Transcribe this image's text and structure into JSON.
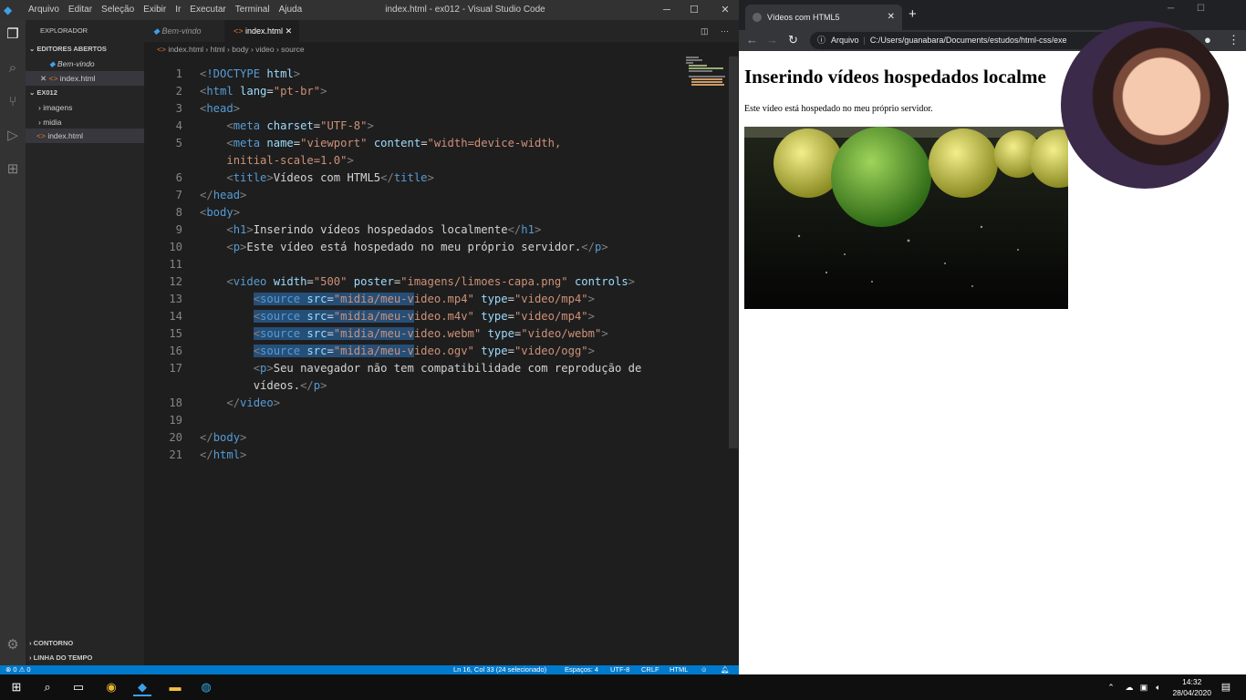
{
  "vscode": {
    "menu": [
      "Arquivo",
      "Editar",
      "Seleção",
      "Exibir",
      "Ir",
      "Executar",
      "Terminal",
      "Ajuda"
    ],
    "window_title": "index.html - ex012 - Visual Studio Code",
    "sidebar": {
      "title": "EXPLORADOR",
      "open_editors": "EDITORES ABERTOS",
      "open_files": [
        "Bem-vindo",
        "index.html"
      ],
      "folder": "EX012",
      "items": [
        "imagens",
        "midia",
        "index.html"
      ],
      "outline": "CONTORNO",
      "timeline": "LINHA DO TEMPO"
    },
    "tabs": [
      "Bem-vindo",
      "index.html"
    ],
    "breadcrumb": [
      "index.html",
      "html",
      "body",
      "video",
      "source"
    ],
    "status": {
      "errors": "⊗ 0 ⚠ 0",
      "position": "Ln 16, Col 33 (24 selecionado)",
      "spaces": "Espaços: 4",
      "encoding": "UTF-8",
      "eol": "CRLF",
      "language": "HTML"
    }
  },
  "browser": {
    "tab_title": "Vídeos com HTML5",
    "address_label": "Arquivo",
    "address": "C:/Users/guanabara/Documents/estudos/html-css/exe",
    "page": {
      "heading": "Inserindo vídeos hospedados localme",
      "paragraph": "Este vídeo está hospedado no meu próprio servidor."
    }
  },
  "taskbar": {
    "time": "14:32",
    "date": "28/04/2020"
  },
  "icons": [
    "vscode-logo",
    "files-icon",
    "search-icon",
    "source-control-icon",
    "run-icon",
    "extensions-icon",
    "settings-icon",
    "windows-start-icon",
    "chrome-icon",
    "file-explorer-icon",
    "edge-icon"
  ]
}
